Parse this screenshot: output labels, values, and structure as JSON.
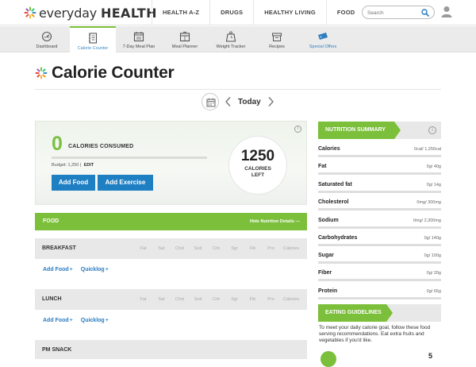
{
  "header": {
    "brand_every": "everyday",
    "brand_health": "HEALTH",
    "nav": [
      "HEALTH A-Z",
      "DRUGS",
      "HEALTHY LIVING",
      "FOOD"
    ],
    "search_placeholder": "Search"
  },
  "subnav": {
    "tabs": [
      {
        "label": "Dashboard",
        "icon": "dashboard-icon"
      },
      {
        "label": "Calorie Counter",
        "icon": "notebook-icon",
        "active": true
      },
      {
        "label": "7-Day Meal Plan",
        "icon": "calendar-icon"
      },
      {
        "label": "Meal Planner",
        "icon": "planner-icon"
      },
      {
        "label": "Weight Tracker",
        "icon": "scale-icon"
      },
      {
        "label": "Recipes",
        "icon": "recipe-box-icon"
      },
      {
        "label": "Special Offers",
        "icon": "ticket-icon"
      }
    ]
  },
  "page": {
    "title": "Calorie Counter",
    "date_label": "Today"
  },
  "calories": {
    "consumed_value": "0",
    "consumed_label": "CALORIES CONSUMED",
    "budget_text": "Budget: 1,250 |",
    "edit_label": "EDIT",
    "add_food_label": "Add Food",
    "add_exercise_label": "Add Exercise",
    "left_value": "1250",
    "left_label_line1": "CALORIES",
    "left_label_line2": "LEFT",
    "info": "i"
  },
  "food": {
    "header_label": "FOOD",
    "hide_details_label": "Hide Nutrition Details —",
    "columns": [
      "Fat",
      "Sat",
      "Chol",
      "Sod",
      "Crb",
      "Sgr",
      "Fib",
      "Pro",
      "Calories"
    ],
    "meals": [
      {
        "name": "BREAKFAST",
        "add_food": "Add Food",
        "quicklog": "Quicklog"
      },
      {
        "name": "LUNCH",
        "add_food": "Add Food",
        "quicklog": "Quicklog"
      },
      {
        "name": "PM SNACK"
      }
    ],
    "plus": "+"
  },
  "nutrition": {
    "title": "NUTRITION SUMMARY",
    "info": "i",
    "rows": [
      {
        "label": "Calories",
        "value": "0cal/ 1,250cal"
      },
      {
        "label": "Fat",
        "value": "0g/ 40g"
      },
      {
        "label": "Saturated fat",
        "value": "0g/ 14g"
      },
      {
        "label": "Cholesterol",
        "value": "0mg/ 300mg"
      },
      {
        "label": "Sodium",
        "value": "0mg/ 2,300mg"
      },
      {
        "label": "Carbohydrates",
        "value": "0g/ 140g"
      },
      {
        "label": "Sugar",
        "value": "0g/ 100g"
      },
      {
        "label": "Fiber",
        "value": "0g/ 20g"
      },
      {
        "label": "Protein",
        "value": "0g/ 65g"
      }
    ]
  },
  "guidelines": {
    "title": "EATING GUIDELINES",
    "text": "To meet your daily calorie goal, follow these food serving recommendations. Eat extra fruits and vegetables if you'd like.",
    "partial_number": "5"
  },
  "colors": {
    "accent_green": "#7bbf3a",
    "button_blue": "#1f7fc3",
    "link_blue": "#2a7bbf"
  }
}
